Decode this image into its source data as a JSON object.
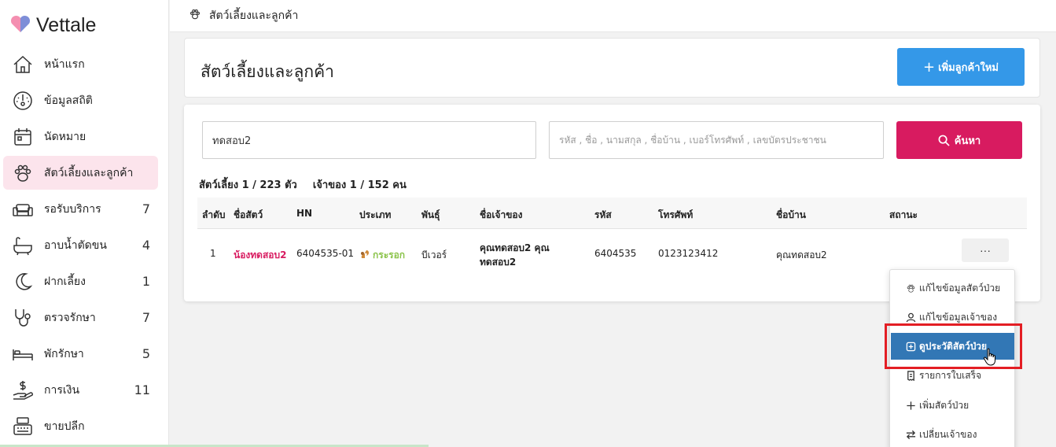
{
  "brand": {
    "name": "Vettale"
  },
  "sidebar": {
    "items": [
      {
        "label": "หน้าแรก",
        "icon": "home-icon",
        "count": ""
      },
      {
        "label": "ข้อมูลสถิติ",
        "icon": "dashboard-icon",
        "count": ""
      },
      {
        "label": "นัดหมาย",
        "icon": "calendar-icon",
        "count": ""
      },
      {
        "label": "สัตว์เลี้ยงและลูกค้า",
        "icon": "paw-icon",
        "count": "",
        "active": true
      },
      {
        "label": "รอรับบริการ",
        "icon": "sofa-icon",
        "count": "7"
      },
      {
        "label": "อาบน้ำตัดขน",
        "icon": "bathtub-icon",
        "count": "4"
      },
      {
        "label": "ฝากเลี้ยง",
        "icon": "moon-icon",
        "count": "1"
      },
      {
        "label": "ตรวจรักษา",
        "icon": "stethoscope-icon",
        "count": "7"
      },
      {
        "label": "พักรักษา",
        "icon": "bed-icon",
        "count": "5"
      },
      {
        "label": "การเงิน",
        "icon": "money-hand-icon",
        "count": "11"
      },
      {
        "label": "ขายปลีก",
        "icon": "cash-register-icon",
        "count": ""
      }
    ]
  },
  "topbar": {
    "title": "สัตว์เลี้ยงและลูกค้า"
  },
  "header": {
    "title": "สัตว์เลี้ยงและลูกค้า",
    "add_label": "เพิ่มลูกค้าใหม่"
  },
  "search": {
    "value": "ทดสอบ2",
    "placeholder": "รหัส , ชื่อ , นามสกุล , ชื่อบ้าน , เบอร์โทรศัพท์ , เลขบัตรประชาชน",
    "button_label": "ค้นหา"
  },
  "counts": {
    "pets": "สัตว์เลี้ยง 1 / 223 ตัว",
    "owners": "เจ้าของ 1 / 152 คน"
  },
  "table": {
    "headers": [
      "ลำดับ",
      "ชื่อสัตว์",
      "HN",
      "ประเภท",
      "พันธุ์",
      "ชื่อเจ้าของ",
      "รหัส",
      "โทรศัพท์",
      "ชื่อบ้าน",
      "สถานะ"
    ],
    "rows": [
      {
        "index": "1",
        "pet_name": "น้องทดสอบ2",
        "hn": "6404535-01",
        "species": "กระรอก",
        "breed": "บีเวอร์",
        "owner": "คุณทดสอบ2 คุณทดสอบ2",
        "code": "6404535",
        "phone": "0123123412",
        "house": "คุณทดสอบ2",
        "status": ""
      }
    ],
    "more_label": "···"
  },
  "dropdown": {
    "items": [
      {
        "label": "แก้ไขข้อมูลสัตว์ป่วย",
        "icon": "paw-icon"
      },
      {
        "label": "แก้ไขข้อมูลเจ้าของ",
        "icon": "user-icon"
      },
      {
        "label": "ดูประวัติสัตว์ป่วย",
        "icon": "medical-record-icon",
        "active": true
      },
      {
        "label": "รายการใบเสร็จ",
        "icon": "receipt-icon"
      },
      {
        "label": "เพิ่มสัตว์ป่วย",
        "icon": "plus-icon"
      },
      {
        "label": "เปลี่ยนเจ้าของ",
        "icon": "swap-icon"
      }
    ]
  },
  "colors": {
    "accent_pink": "#d81b60",
    "accent_blue": "#3498e8",
    "menu_active": "#3277b5",
    "highlight": "#e31e24"
  }
}
